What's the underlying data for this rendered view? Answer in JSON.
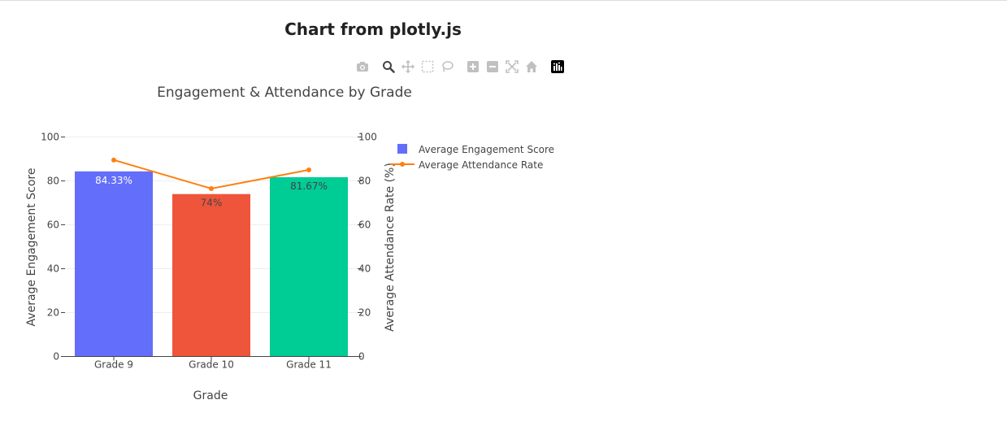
{
  "page": {
    "title": "Chart from plotly.js"
  },
  "modebar": {
    "buttons": [
      {
        "icon": "camera-icon",
        "label": "Download plot as a png"
      },
      {
        "icon": "zoom-icon",
        "label": "Zoom",
        "active": true
      },
      {
        "icon": "pan-icon",
        "label": "Pan"
      },
      {
        "icon": "box-select-icon",
        "label": "Box Select"
      },
      {
        "icon": "lasso-select-icon",
        "label": "Lasso Select"
      },
      {
        "icon": "zoom-in-icon",
        "label": "Zoom in"
      },
      {
        "icon": "zoom-out-icon",
        "label": "Zoom out"
      },
      {
        "icon": "autoscale-icon",
        "label": "Autoscale"
      },
      {
        "icon": "reset-axes-icon",
        "label": "Reset axes"
      },
      {
        "icon": "plotly-logo-icon",
        "label": "Produced with Plotly"
      }
    ],
    "icon_color": "#c0c0c0",
    "active_icon_color": "#444444"
  },
  "chart_data": {
    "type": "bar",
    "title": "Engagement & Attendance by Grade",
    "xlabel": "Grade",
    "ylabel": "Average Engagement Score",
    "y2label": "Average Attendance Rate (%)",
    "categories": [
      "Grade 9",
      "Grade 10",
      "Grade 11"
    ],
    "ylim": [
      0,
      100
    ],
    "y2lim": [
      0,
      100
    ],
    "yticks": [
      0,
      20,
      40,
      60,
      80,
      100
    ],
    "y2ticks": [
      0,
      20,
      40,
      60,
      80,
      100
    ],
    "grid": true,
    "legend_position": "top-right",
    "series": [
      {
        "name": "Average Engagement Score",
        "type": "bar",
        "axis": "y",
        "values": [
          84.33,
          74,
          81.67
        ],
        "labels": [
          "84.33%",
          "74%",
          "81.67%"
        ],
        "colors": [
          "#636efa",
          "#ef553b",
          "#00cc96"
        ],
        "label_colors": [
          "#ffffff",
          "#444444",
          "#444444"
        ],
        "legend_color": "#636efa"
      },
      {
        "name": "Average Attendance Rate",
        "type": "line",
        "axis": "y2",
        "values": [
          89.5,
          76.5,
          85
        ],
        "color": "#ff7f0e"
      }
    ]
  }
}
